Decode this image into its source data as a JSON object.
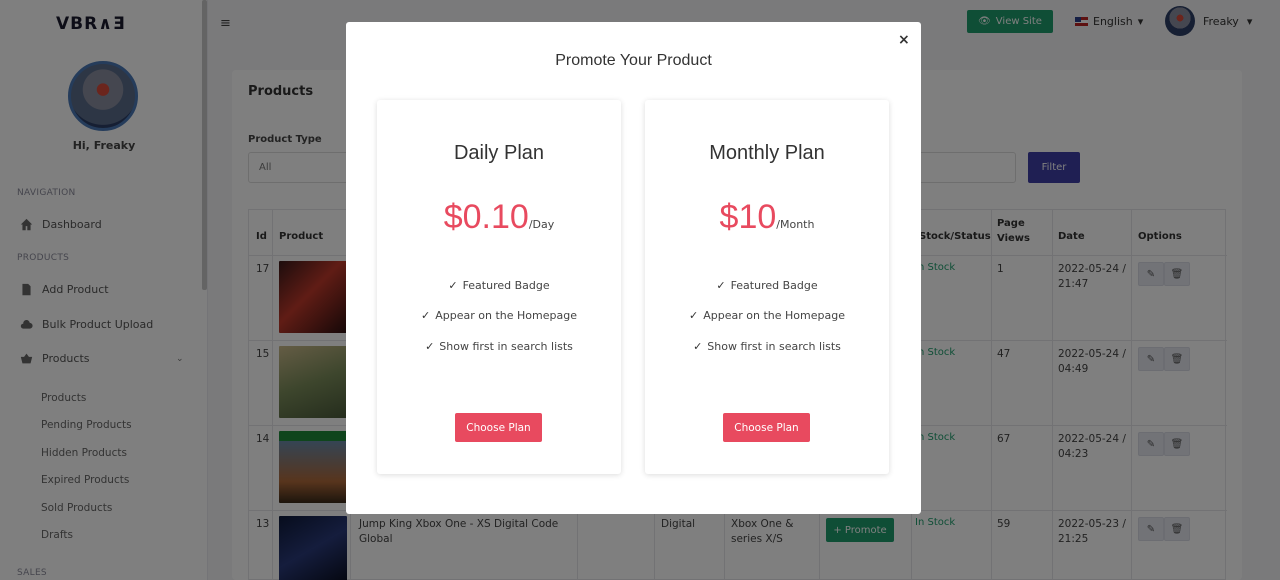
{
  "brand": {
    "logo_text": "VBR∧Ǝ"
  },
  "sidebar": {
    "greeting": "Hi, Freaky",
    "nav_header": "NAVIGATION",
    "dashboard": "Dashboard",
    "products_header": "PRODUCTS",
    "add_product": "Add Product",
    "bulk_upload": "Bulk Product Upload",
    "products": "Products",
    "sub_items": [
      "Products",
      "Pending Products",
      "Hidden Products",
      "Expired Products",
      "Sold Products",
      "Drafts"
    ],
    "sales_header": "SALES"
  },
  "topbar": {
    "view_site": "View Site",
    "language": "English",
    "user": "Freaky"
  },
  "page": {
    "title": "Products",
    "product_type_label": "Product Type",
    "product_type_value": "All",
    "filter_button": "Filter"
  },
  "table": {
    "headers": {
      "id": "Id",
      "product": "Product",
      "stock": "Stock/Status",
      "views": "Page Views",
      "date": "Date",
      "options": "Options"
    },
    "rows": [
      {
        "id": "17",
        "stock": "In Stock",
        "views": "1",
        "date": "2022-05-24 / 21:47"
      },
      {
        "id": "15",
        "stock": "In Stock",
        "views": "47",
        "date": "2022-05-24 / 04:49"
      },
      {
        "id": "14",
        "stock": "In Stock",
        "views": "67",
        "date": "2022-05-24 / 04:23"
      },
      {
        "id": "13",
        "name": "Jump King Xbox One - XS Digital Code Global",
        "type": "Digital",
        "category": "Xbox One & series X/S",
        "promote": "+ Promote",
        "stock": "In Stock",
        "views": "59",
        "date": "2022-05-23 / 21:25"
      }
    ]
  },
  "modal": {
    "title": "Promote Your Product",
    "close": "×",
    "plans": [
      {
        "name": "Daily Plan",
        "price": "$0.10",
        "unit": "/Day",
        "features": [
          "Featured Badge",
          "Appear on the Homepage",
          "Show first in search lists"
        ],
        "button": "Choose Plan"
      },
      {
        "name": "Monthly Plan",
        "price": "$10",
        "unit": "/Month",
        "features": [
          "Featured Badge",
          "Appear on the Homepage",
          "Show first in search lists"
        ],
        "button": "Choose Plan"
      }
    ]
  },
  "colors": {
    "accent": "#e84a5f",
    "green": "#1f9d6d",
    "filter": "#3f3fa6"
  }
}
